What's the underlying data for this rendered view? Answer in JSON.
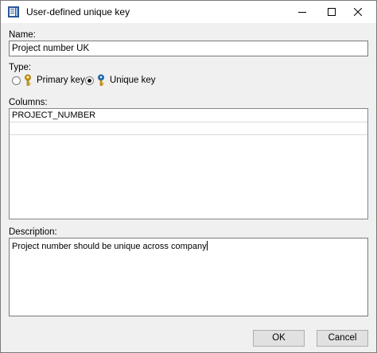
{
  "window": {
    "title": "User-defined unique key"
  },
  "name_section": {
    "label": "Name:",
    "value": "Project number UK"
  },
  "type_section": {
    "label": "Type:",
    "options": [
      {
        "label": "Primary key",
        "checked": false,
        "icon": "primary-key-icon"
      },
      {
        "label": "Unique key",
        "checked": true,
        "icon": "unique-key-icon"
      }
    ]
  },
  "columns_section": {
    "label": "Columns:",
    "rows": [
      "PROJECT_NUMBER",
      ""
    ]
  },
  "description_section": {
    "label": "Description:",
    "value": "Project number should be unique across company"
  },
  "buttons": {
    "ok": "OK",
    "cancel": "Cancel"
  },
  "colors": {
    "primary_key_accent": "#d4a017",
    "unique_key_accent": "#1e73be",
    "app_icon": "#2b5797"
  }
}
